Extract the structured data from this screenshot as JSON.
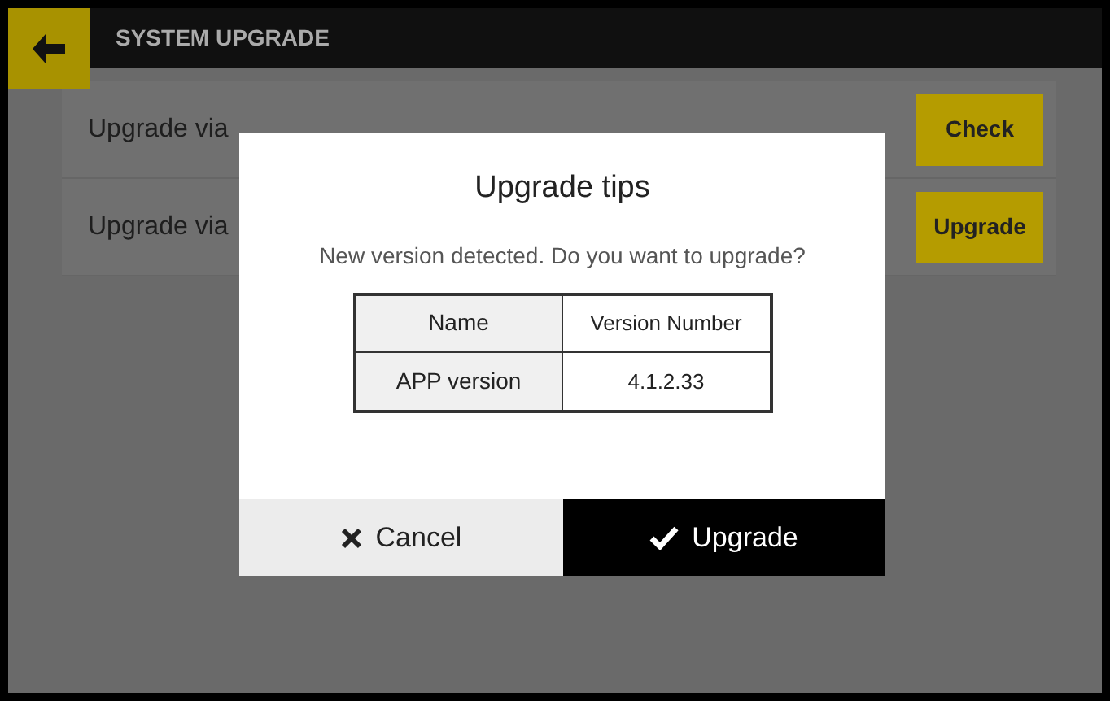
{
  "header": {
    "title": "SYSTEM UPGRADE"
  },
  "rows": [
    {
      "label": "Upgrade via",
      "button": "Check"
    },
    {
      "label": "Upgrade via",
      "button": "Upgrade"
    }
  ],
  "dialog": {
    "title": "Upgrade tips",
    "message": "New version detected. Do you want to upgrade?",
    "table": {
      "columns": [
        "Name",
        "Version Number"
      ],
      "rows": [
        [
          "APP version",
          "4.1.2.33"
        ]
      ]
    },
    "buttons": [
      {
        "label": "Cancel",
        "kind": "cancel"
      },
      {
        "label": "Upgrade",
        "kind": "confirm"
      }
    ]
  }
}
